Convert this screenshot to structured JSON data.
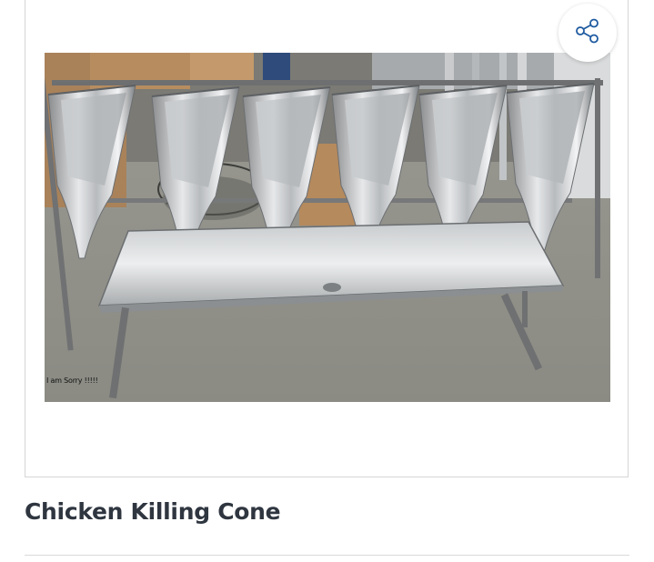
{
  "card": {
    "share_icon": "share-icon",
    "accent_color": "#1e5aa0"
  },
  "photo": {
    "caption": "I am Sorry !!!!!"
  },
  "product": {
    "title": "Chicken Killing Cone"
  }
}
